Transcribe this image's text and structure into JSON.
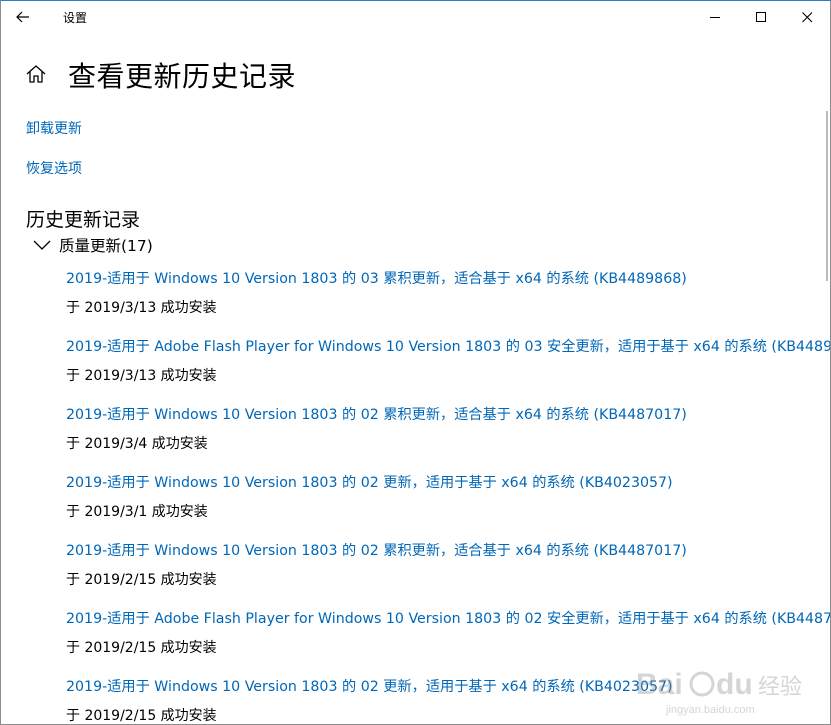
{
  "window": {
    "title": "设置",
    "accent": "#0067b8"
  },
  "titlebar": {
    "back_icon": "arrow-left-icon",
    "minimize_icon": "minimize-icon",
    "maximize_icon": "maximize-icon",
    "close_icon": "close-icon"
  },
  "page": {
    "home_icon": "home-icon",
    "title": "查看更新历史记录",
    "links": {
      "uninstall": "卸载更新",
      "recovery": "恢复选项"
    },
    "section_title": "历史更新记录",
    "group": {
      "label": "质量更新(17)",
      "expanded": true
    }
  },
  "updates": [
    {
      "title": "2019-适用于 Windows 10 Version 1803 的 03 累积更新，适合基于 x64 的系统 (KB4489868)",
      "status": "于 2019/3/13 成功安装"
    },
    {
      "title": "2019-适用于 Adobe Flash Player for Windows 10 Version 1803 的 03 安全更新，适用于基于 x64 的系统 (KB44899",
      "status": "于 2019/3/13 成功安装"
    },
    {
      "title": "2019-适用于 Windows 10 Version 1803 的 02 累积更新，适合基于 x64 的系统 (KB4487017)",
      "status": "于 2019/3/4 成功安装"
    },
    {
      "title": "2019-适用于 Windows 10 Version 1803 的 02 更新，适用于基于 x64 的系统 (KB4023057)",
      "status": "于 2019/3/1 成功安装"
    },
    {
      "title": "2019-适用于 Windows 10 Version 1803 的 02 累积更新，适合基于 x64 的系统 (KB4487017)",
      "status": "于 2019/2/15 成功安装"
    },
    {
      "title": "2019-适用于 Adobe Flash Player for Windows 10 Version 1803 的 02 安全更新，适用于基于 x64 的系统 (KB44870",
      "status": "于 2019/2/15 成功安装"
    },
    {
      "title": "2019-适用于 Windows 10 Version 1803 的 02 更新，适用于基于 x64 的系统 (KB4023057)",
      "status": "于 2019/2/15 成功安装"
    }
  ],
  "watermark": {
    "text": "Baidu经验",
    "subtext": "jingyan.baidu.com"
  }
}
